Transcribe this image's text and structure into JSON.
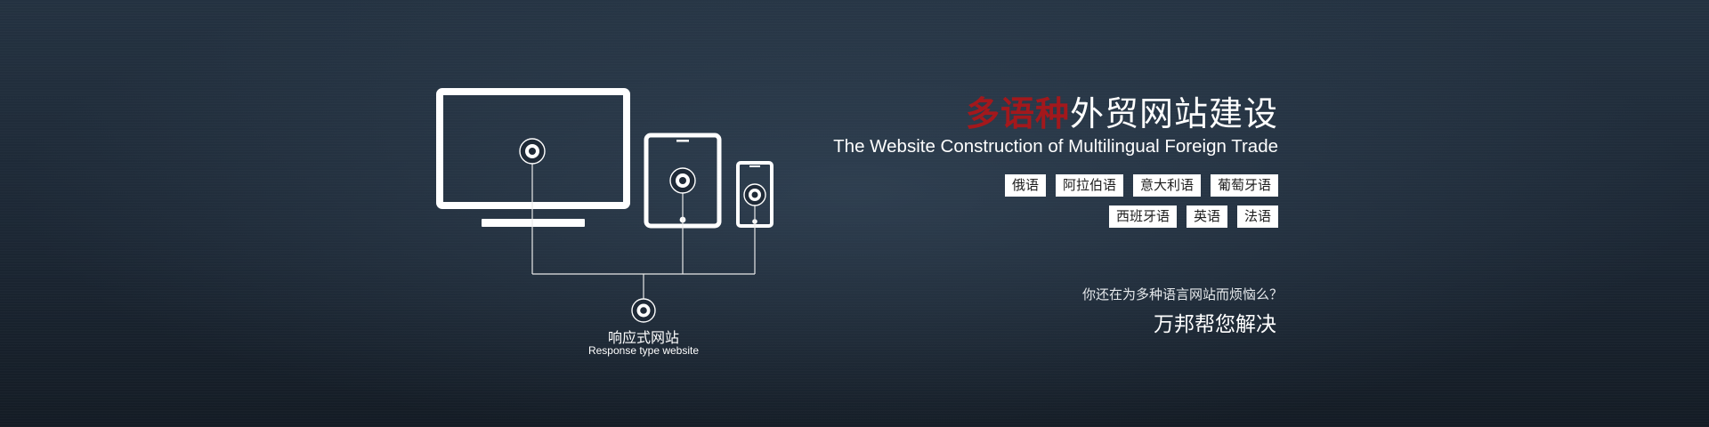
{
  "banner": {
    "headline": {
      "highlight": "多语种",
      "rest": "外贸网站建设"
    },
    "subtitle": "The Website Construction of Multilingual Foreign Trade",
    "language_tags_row1": [
      "俄语",
      "阿拉伯语",
      "意大利语",
      "葡萄牙语"
    ],
    "language_tags_row2": [
      "西班牙语",
      "英语",
      "法语"
    ],
    "question": "你还在为多种语言网站而烦恼么？",
    "solution": "万邦帮您解决",
    "diagram": {
      "label_cn": "响应式网站",
      "label_en": "Response type website",
      "icons": [
        "monitor-icon",
        "tablet-icon",
        "phone-icon",
        "target-icon"
      ]
    },
    "colors": {
      "accent_red": "#a3181c",
      "background": "#1c2734",
      "foreground": "#ffffff"
    }
  }
}
